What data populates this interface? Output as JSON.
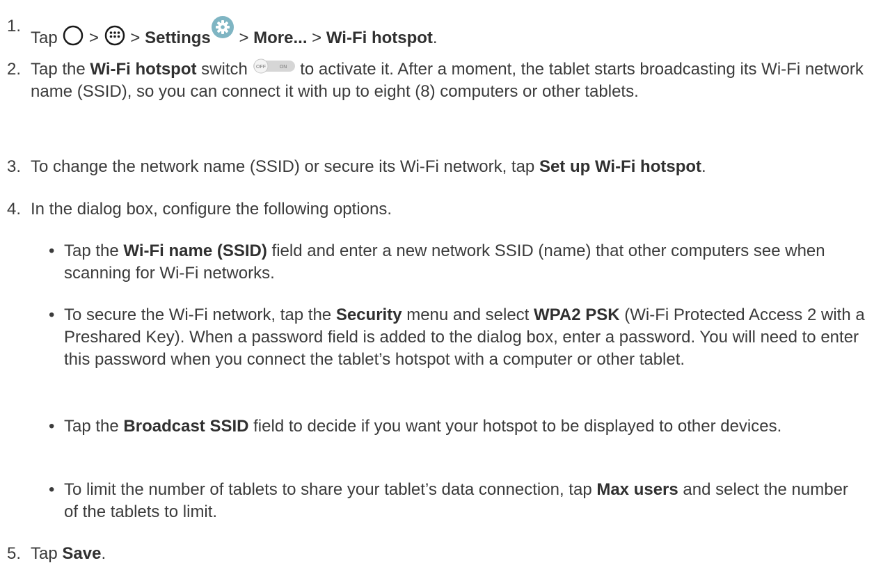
{
  "steps": [
    {
      "num": "1.",
      "tap": "Tap",
      "sep": ">",
      "settings": "Settings",
      "more": "More...",
      "wifi_hotspot": "Wi-Fi hotspot",
      "end": ".",
      "icons": [
        "home-circle-icon",
        "apps-grid-icon",
        "settings-gear-icon"
      ]
    },
    {
      "num": "2.",
      "pre": "Tap the",
      "bold": "Wi-Fi hotspot",
      "mid": "switch",
      "toggle_off": "OFF",
      "toggle_on": "ON",
      "post": "to activate it. After a moment, the tablet starts broadcasting its Wi-Fi network name (SSID), so you can connect it with up to eight (8) computers or other tablets."
    },
    {
      "num": "3.",
      "pre": "To change the network name (SSID) or secure its Wi-Fi network, tap",
      "bold": "Set up Wi-Fi hotspot",
      "end": "."
    },
    {
      "num": "4.",
      "text": "In the dialog box, configure the following options."
    },
    {
      "num": "5.",
      "pre": "Tap",
      "bold": "Save",
      "end": "."
    }
  ],
  "bullets": [
    {
      "pre": "Tap the",
      "bold": "Wi-Fi name (SSID)",
      "post": "field and enter a new network SSID (name) that other computers see when scanning for Wi-Fi networks."
    },
    {
      "pre": "To secure the Wi-Fi network, tap the",
      "bold": "Security",
      "mid": "menu and select",
      "bold2": "WPA2 PSK",
      "post": "(Wi-Fi Protected Access 2 with a Preshared Key). When a password field is added to the dialog box, enter a password. You will need to enter this password when you connect the tablet’s hotspot with a computer or other tablet."
    },
    {
      "pre": "Tap the",
      "bold": "Broadcast SSID",
      "post": "field to decide if you want your hotspot to be displayed to other devices."
    },
    {
      "pre": "To limit the number of tablets to share your tablet’s data connection, tap",
      "bold": "Max users",
      "post": "and select the number of the tablets to limit."
    }
  ],
  "bullet_char": "•",
  "colors": {
    "text": "#3b3b3b",
    "icon": "#1a1a1a",
    "settings_icon": "#7fb5c3",
    "toggle": "#d6d6d6"
  }
}
